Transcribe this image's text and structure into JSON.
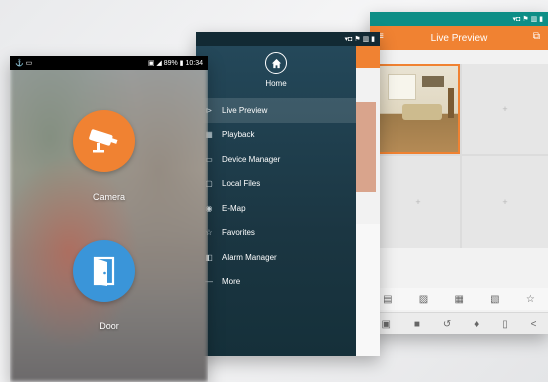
{
  "phone_back": {
    "header_title": "Live Preview",
    "status_icons": "▾◘ ⚑ ▥ ▮",
    "grid_cells": [
      "",
      "+",
      "+",
      "+"
    ],
    "toolbar_row1": [
      "▤",
      "▨",
      "▦",
      "▧",
      "☆"
    ],
    "toolbar_row2": [
      "▣",
      "■",
      "↺",
      "♦",
      "▯",
      "<"
    ]
  },
  "phone_middle": {
    "status_icons": "▾◘ ⚑ ▥ ▮",
    "home_label": "Home",
    "menu": [
      {
        "icon": "⊳",
        "label": "Live Preview"
      },
      {
        "icon": "▦",
        "label": "Playback"
      },
      {
        "icon": "▭",
        "label": "Device Manager"
      },
      {
        "icon": "▢",
        "label": "Local Files"
      },
      {
        "icon": "◉",
        "label": "E-Map"
      },
      {
        "icon": "☆",
        "label": "Favorites"
      },
      {
        "icon": "◧",
        "label": "Alarm Manager"
      },
      {
        "icon": "—",
        "label": "More"
      }
    ]
  },
  "phone_front": {
    "status_left": "⚓ ▭",
    "status_right": "▣ ◢ 89% ▮ 10:34",
    "camera_label": "Camera",
    "door_label": "Door"
  },
  "colors": {
    "accent_orange": "#f08232",
    "accent_blue": "#3a95d9",
    "status_teal": "#0d8e86",
    "drawer_dark": "#1e3b49"
  }
}
